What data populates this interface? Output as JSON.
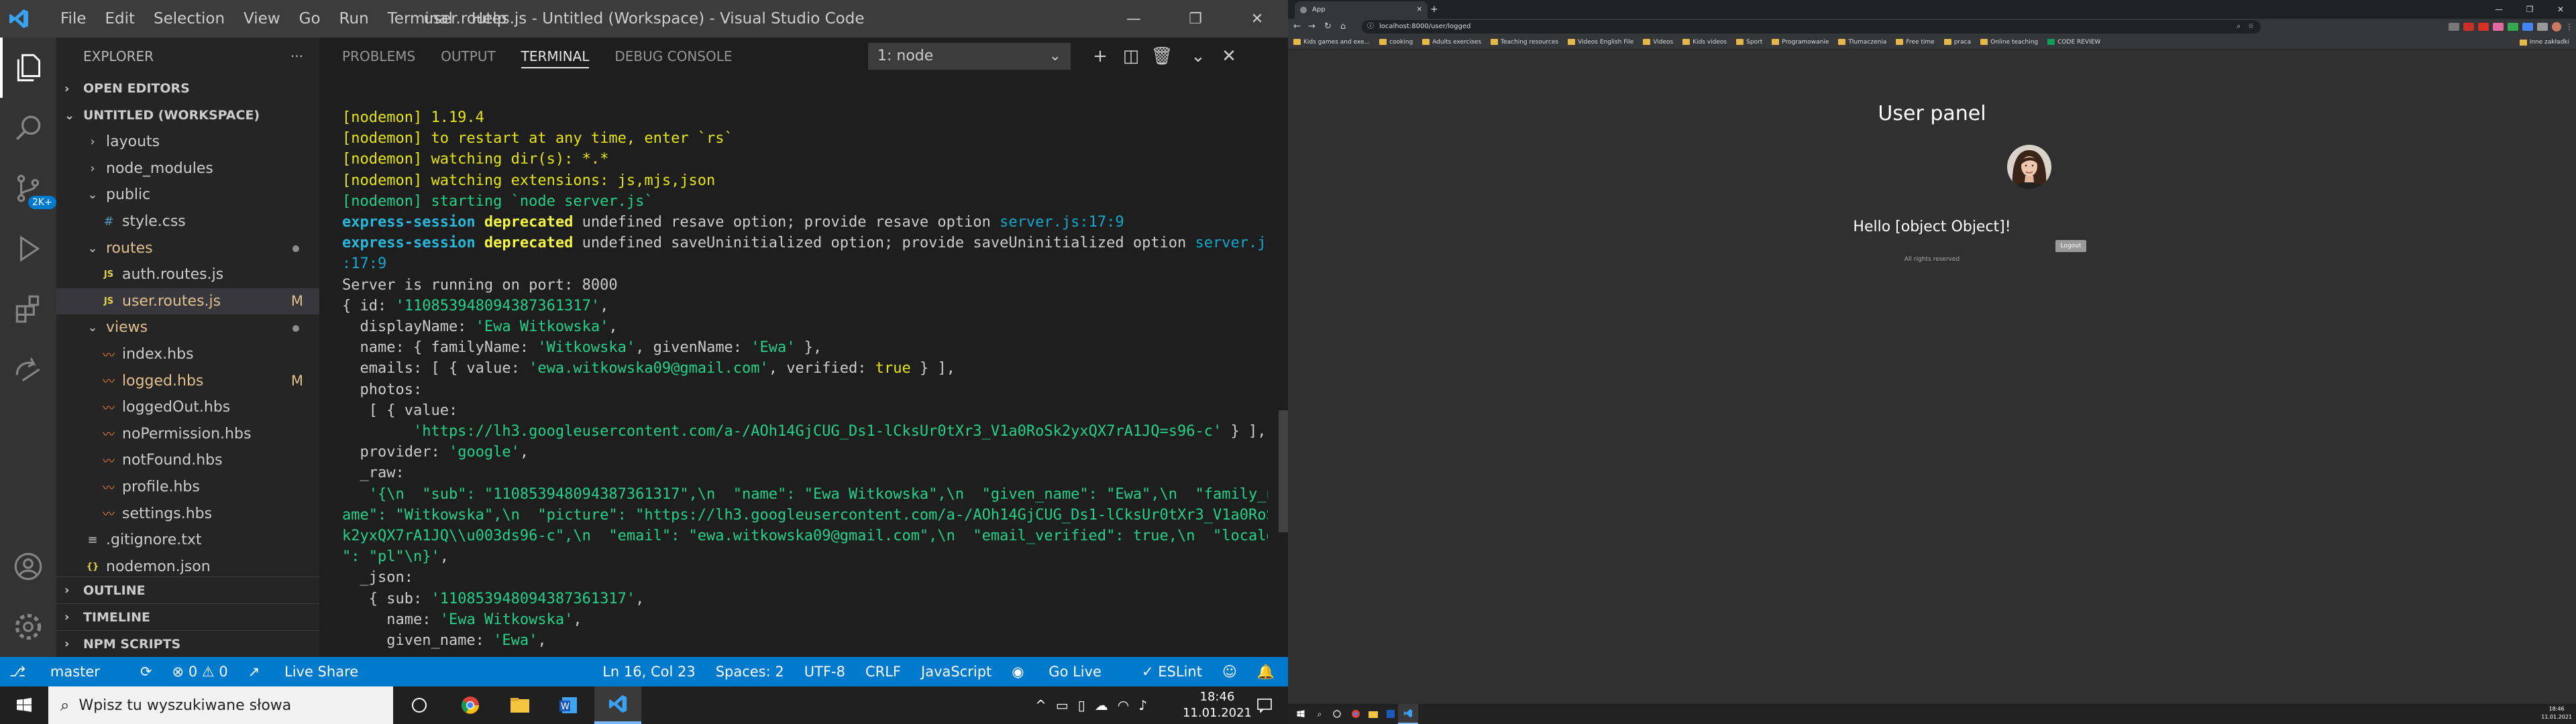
{
  "vscode": {
    "menus": [
      "File",
      "Edit",
      "Selection",
      "View",
      "Go",
      "Run",
      "Terminal",
      "Help"
    ],
    "title": "user.routes.js - Untitled (Workspace) - Visual Studio Code",
    "badge": "2K+",
    "explorer": {
      "header": "EXPLORER",
      "more": "···",
      "open_editors": "OPEN EDITORS",
      "workspace": "UNTITLED (WORKSPACE)",
      "tree": [
        {
          "label": "layouts",
          "kind": "folder-closed",
          "level": 1,
          "color": "#cccccc"
        },
        {
          "label": "node_modules",
          "kind": "folder-closed",
          "level": 1,
          "color": "#cccccc"
        },
        {
          "label": "public",
          "kind": "folder-open",
          "level": 1,
          "color": "#cccccc"
        },
        {
          "label": "style.css",
          "kind": "css",
          "level": 2,
          "color": "#cccccc"
        },
        {
          "label": "routes",
          "kind": "folder-open",
          "level": 1,
          "color": "#e2c08d",
          "dot": true
        },
        {
          "label": "auth.routes.js",
          "kind": "js",
          "level": 2,
          "color": "#cccccc"
        },
        {
          "label": "user.routes.js",
          "kind": "js",
          "level": 2,
          "color": "#e2c08d",
          "status": "M",
          "selected": true
        },
        {
          "label": "views",
          "kind": "folder-open",
          "level": 1,
          "color": "#e2c08d",
          "dot": true
        },
        {
          "label": "index.hbs",
          "kind": "hbs",
          "level": 2,
          "color": "#cccccc"
        },
        {
          "label": "logged.hbs",
          "kind": "hbs",
          "level": 2,
          "color": "#e2c08d",
          "status": "M"
        },
        {
          "label": "loggedOut.hbs",
          "kind": "hbs",
          "level": 2,
          "color": "#cccccc"
        },
        {
          "label": "noPermission.hbs",
          "kind": "hbs",
          "level": 2,
          "color": "#cccccc"
        },
        {
          "label": "notFound.hbs",
          "kind": "hbs",
          "level": 2,
          "color": "#cccccc"
        },
        {
          "label": "profile.hbs",
          "kind": "hbs",
          "level": 2,
          "color": "#cccccc"
        },
        {
          "label": "settings.hbs",
          "kind": "hbs",
          "level": 2,
          "color": "#cccccc"
        },
        {
          "label": ".gitignore.txt",
          "kind": "txt",
          "level": 1,
          "color": "#cccccc"
        },
        {
          "label": "nodemon.json",
          "kind": "json",
          "level": 1,
          "color": "#cccccc"
        }
      ],
      "outline": "OUTLINE",
      "timeline": "TIMELINE",
      "npm": "NPM SCRIPTS"
    },
    "panel": {
      "tabs": [
        "PROBLEMS",
        "OUTPUT",
        "TERMINAL",
        "DEBUG CONSOLE"
      ],
      "active": "TERMINAL",
      "terminal_select": "1: node"
    },
    "terminal": [
      [
        {
          "t": "[nodemon] 1.19.4",
          "c": "y"
        }
      ],
      [
        {
          "t": "[nodemon] to restart at any time, enter `rs`",
          "c": "y"
        }
      ],
      [
        {
          "t": "[nodemon] watching dir(s): *.*",
          "c": "y"
        }
      ],
      [
        {
          "t": "[nodemon] watching extensions: js,mjs,json",
          "c": "y"
        }
      ],
      [
        {
          "t": "[nodemon] starting `node server.js`",
          "c": "g"
        }
      ],
      [
        {
          "t": "express-session ",
          "c": "cb"
        },
        {
          "t": "deprecated",
          "c": "yb"
        },
        {
          "t": " undefined resave option; provide resave option ",
          "c": ""
        },
        {
          "t": "server.js:17:9",
          "c": "c"
        }
      ],
      [
        {
          "t": "express-session ",
          "c": "cb"
        },
        {
          "t": "deprecated",
          "c": "yb"
        },
        {
          "t": " undefined saveUninitialized option; provide saveUninitialized option ",
          "c": ""
        },
        {
          "t": "server.js",
          "c": "c"
        }
      ],
      [
        {
          "t": ":17:9",
          "c": "c"
        }
      ],
      [
        {
          "t": "Server is running on port: 8000",
          "c": ""
        }
      ],
      [
        {
          "t": "{ id: ",
          "c": ""
        },
        {
          "t": "'110853948094387361317'",
          "c": "g"
        },
        {
          "t": ",",
          "c": ""
        }
      ],
      [
        {
          "t": "  displayName: ",
          "c": ""
        },
        {
          "t": "'Ewa Witkowska'",
          "c": "g"
        },
        {
          "t": ",",
          "c": ""
        }
      ],
      [
        {
          "t": "  name: { familyName: ",
          "c": ""
        },
        {
          "t": "'Witkowska'",
          "c": "g"
        },
        {
          "t": ", givenName: ",
          "c": ""
        },
        {
          "t": "'Ewa'",
          "c": "g"
        },
        {
          "t": " },",
          "c": ""
        }
      ],
      [
        {
          "t": "  emails: [ { value: ",
          "c": ""
        },
        {
          "t": "'ewa.witkowska09@gmail.com'",
          "c": "g"
        },
        {
          "t": ", verified: ",
          "c": ""
        },
        {
          "t": "true",
          "c": "y"
        },
        {
          "t": " } ],",
          "c": ""
        }
      ],
      [
        {
          "t": "  photos:",
          "c": ""
        }
      ],
      [
        {
          "t": "   [ { value:",
          "c": ""
        }
      ],
      [
        {
          "t": "        'https://lh3.googleusercontent.com/a-/AOh14GjCUG_Ds1-lCksUr0tXr3_V1a0RoSk2yxQX7rA1JQ=s96-c'",
          "c": "g"
        },
        {
          "t": " } ],",
          "c": ""
        }
      ],
      [
        {
          "t": "  provider: ",
          "c": ""
        },
        {
          "t": "'google'",
          "c": "g"
        },
        {
          "t": ",",
          "c": ""
        }
      ],
      [
        {
          "t": "  _raw:",
          "c": ""
        }
      ],
      [
        {
          "t": "   '{\\n  \"sub\": \"110853948094387361317\",\\n  \"name\": \"Ewa Witkowska\",\\n  \"given_name\": \"Ewa\",\\n  \"family_n",
          "c": "g"
        }
      ],
      [
        {
          "t": "ame\": \"Witkowska\",\\n  \"picture\": \"https://lh3.googleusercontent.com/a-/AOh14GjCUG_Ds1-lCksUr0tXr3_V1a0RoS",
          "c": "g"
        }
      ],
      [
        {
          "t": "k2yxQX7rA1JQ\\\\u003ds96-c\",\\n  \"email\": \"ewa.witkowska09@gmail.com\",\\n  \"email_verified\": true,\\n  \"locale",
          "c": "g"
        }
      ],
      [
        {
          "t": "\": \"pl\"\\n}'",
          "c": "g"
        },
        {
          "t": ",",
          "c": ""
        }
      ],
      [
        {
          "t": "  _json:",
          "c": ""
        }
      ],
      [
        {
          "t": "   { sub: ",
          "c": ""
        },
        {
          "t": "'110853948094387361317'",
          "c": "g"
        },
        {
          "t": ",",
          "c": ""
        }
      ],
      [
        {
          "t": "     name: ",
          "c": ""
        },
        {
          "t": "'Ewa Witkowska'",
          "c": "g"
        },
        {
          "t": ",",
          "c": ""
        }
      ],
      [
        {
          "t": "     given_name: ",
          "c": ""
        },
        {
          "t": "'Ewa'",
          "c": "g"
        },
        {
          "t": ",",
          "c": ""
        }
      ]
    ],
    "status": {
      "branch": "master",
      "sync": "⟳",
      "problems": "⊗ 0 ⚠ 0",
      "liveshare": "Live Share",
      "position": "Ln 16, Col 23",
      "spaces": "Spaces: 2",
      "encoding": "UTF-8",
      "eol": "CRLF",
      "language": "JavaScript",
      "golive": "Go Live",
      "eslint": "✓ ESLint"
    }
  },
  "taskbar": {
    "search_placeholder": "Wpisz tu wyszukiwane słowa",
    "time": "18:46",
    "date": "11.01.2021"
  },
  "browser": {
    "tab_title": "App",
    "url": "localhost:8000/user/logged",
    "bookmarks": [
      "Kids games and exe...",
      "cooking",
      "Adults exercises",
      "Teaching resources",
      "Videos English File",
      "Videos",
      "Kids videos",
      "Sport",
      "Programowanie",
      "Tłumaczenia",
      "Free time",
      "praca",
      "Online teaching",
      "CODE REVIEW"
    ],
    "other_bookmarks": "Inne zakładki",
    "page": {
      "title": "User panel",
      "greeting": "Hello [object Object]!",
      "logout": "Logout",
      "rights": "All rights reserved"
    },
    "taskbar_time": "18:46",
    "taskbar_date": "11.01.2021"
  },
  "colors": {
    "accent": "#007acc",
    "titlebar": "#3c3c3c",
    "sidebar": "#252526",
    "editor": "#1e1e1e",
    "modified": "#e2c08d"
  }
}
